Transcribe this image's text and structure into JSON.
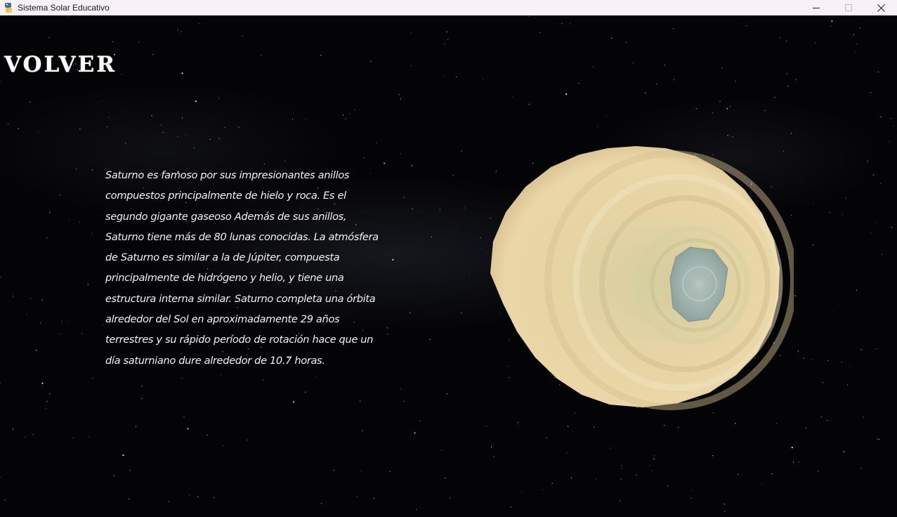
{
  "window": {
    "title": "Sistema Solar Educativo",
    "icon": "python-icon"
  },
  "controls": {
    "minimize_icon": "minimize-icon",
    "maximize_icon": "maximize-icon",
    "close_icon": "close-icon"
  },
  "back_label": "VOLVER",
  "description_lines": [
    "Saturno es famoso por sus impresionantes anillos",
    "compuestos principalmente de hielo y roca. Es el",
    "segundo gigante gaseoso  Además de sus anillos,",
    "Saturno tiene más de 80 lunas conocidas. La atmósfera",
    "de Saturno es similar a la de Júpiter, compuesta",
    "principalmente de hidrógeno y helio, y tiene una",
    "estructura interna similar. Saturno completa una órbita",
    "alrededor del Sol en aproximadamente 29 años",
    "terrestres y su rápido período de rotación hace que un",
    "día saturniano dure alrededor de 10.7 horas."
  ],
  "colors": {
    "planet_base": "#e6d3a3",
    "planet_band_light": "#f0e2bc",
    "planet_band_dark": "#cdb98a",
    "polar_hexagon": "#9fb1ae",
    "text": "#f2f2f2",
    "background": "#040406"
  }
}
